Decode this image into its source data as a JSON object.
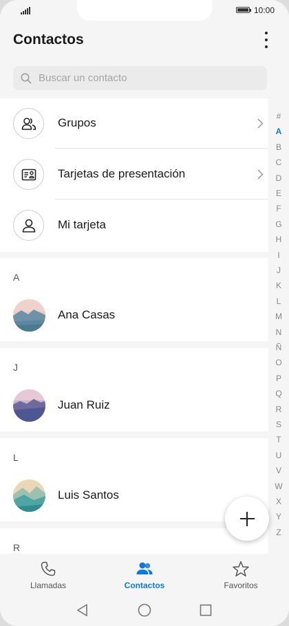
{
  "status": {
    "time": "10:00"
  },
  "header": {
    "title": "Contactos"
  },
  "search": {
    "placeholder": "Buscar un contacto"
  },
  "menu": [
    {
      "label": "Grupos",
      "icon": "group-icon"
    },
    {
      "label": "Tarjetas de presentación",
      "icon": "business-card-icon"
    },
    {
      "label": "Mi tarjeta",
      "icon": "person-icon"
    }
  ],
  "sections": [
    {
      "letter": "A",
      "contact": "Ana Casas"
    },
    {
      "letter": "J",
      "contact": "Juan Ruiz"
    },
    {
      "letter": "L",
      "contact": "Luis Santos"
    },
    {
      "letter": "R",
      "contact": ""
    }
  ],
  "index": [
    "#",
    "A",
    "B",
    "C",
    "D",
    "E",
    "F",
    "G",
    "H",
    "I",
    "J",
    "K",
    "L",
    "M",
    "N",
    "Ñ",
    "O",
    "P",
    "Q",
    "R",
    "S",
    "T",
    "U",
    "V",
    "W",
    "X",
    "Y",
    "Z"
  ],
  "index_active": "A",
  "tabs": [
    {
      "label": "Llamadas",
      "icon": "phone-icon"
    },
    {
      "label": "Contactos",
      "icon": "contacts-icon",
      "active": true
    },
    {
      "label": "Favoritos",
      "icon": "star-icon"
    }
  ],
  "colors": {
    "accent": "#0a7ae2",
    "background": "#f5f5f5"
  }
}
